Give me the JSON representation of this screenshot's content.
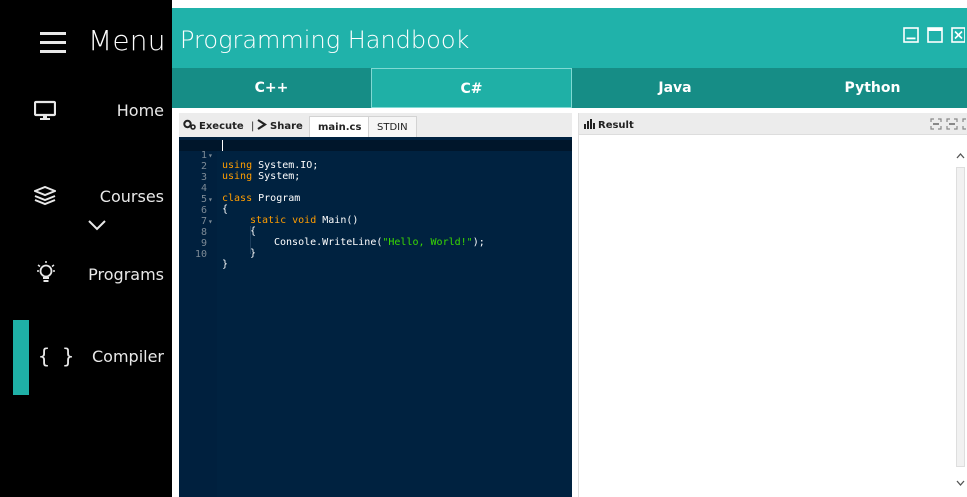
{
  "sidebar": {
    "menu_label": "Menu",
    "items": [
      {
        "label": "Home",
        "icon": "monitor-icon"
      },
      {
        "label": "Courses",
        "icon": "stack-icon"
      },
      {
        "label": "Programs",
        "icon": "lightbulb-icon"
      },
      {
        "label": "Compiler",
        "icon": "braces-icon"
      }
    ]
  },
  "header": {
    "title": "Programming Handbook"
  },
  "tabs": [
    {
      "label": "C++"
    },
    {
      "label": "C#"
    },
    {
      "label": "Java"
    },
    {
      "label": "Python"
    }
  ],
  "editor": {
    "execute_label": "Execute",
    "share_label": "Share",
    "file_tab": "main.cs",
    "stdin_tab": "STDIN",
    "lines": [
      {
        "n": "1",
        "fold": "▾"
      },
      {
        "n": "2",
        "fold": ""
      },
      {
        "n": "3",
        "fold": ""
      },
      {
        "n": "4",
        "fold": ""
      },
      {
        "n": "5",
        "fold": "▾"
      },
      {
        "n": "6",
        "fold": ""
      },
      {
        "n": "7",
        "fold": "▾"
      },
      {
        "n": "8",
        "fold": ""
      },
      {
        "n": "9",
        "fold": ""
      },
      {
        "n": "10",
        "fold": ""
      }
    ],
    "code": {
      "l1_kw": "using",
      "l1_rest": " System.IO;",
      "l2_kw": "using",
      "l2_rest": " System;",
      "l4_kw": "class",
      "l4_rest": " Program",
      "l5": "{",
      "l6_kw": "static void",
      "l6_rest": " Main()",
      "l7": "{",
      "l8_pre": "Console.WriteLine(",
      "l8_str": "\"Hello, World!\"",
      "l8_post": ");",
      "l9": "}",
      "l10": "}"
    }
  },
  "result": {
    "title": "Result"
  },
  "colors": {
    "accent": "#20b2aa",
    "tab_bar": "#168d86",
    "editor_bg": "#002240",
    "keyword": "#ff9d00",
    "string": "#3ad900"
  }
}
